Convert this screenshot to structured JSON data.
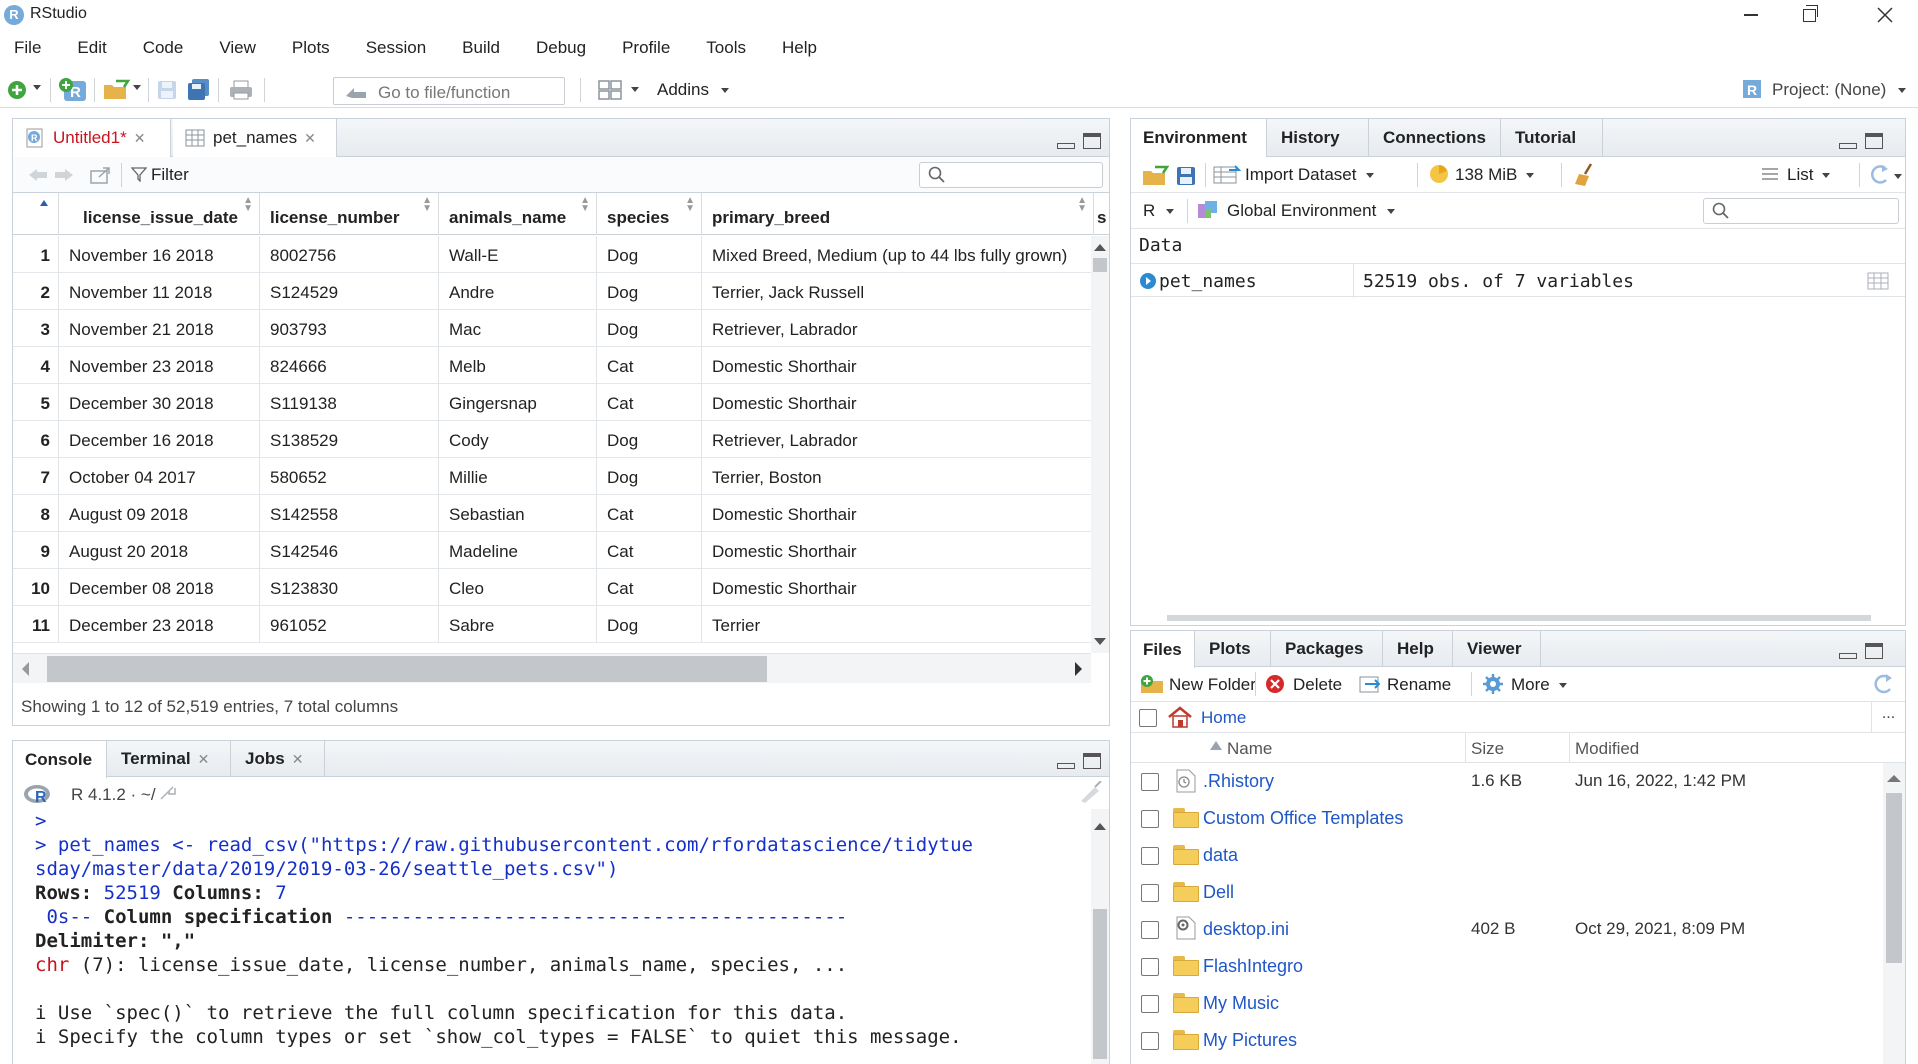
{
  "app": {
    "title": "RStudio",
    "logo_letter": "R"
  },
  "menu": [
    "File",
    "Edit",
    "Code",
    "View",
    "Plots",
    "Session",
    "Build",
    "Debug",
    "Profile",
    "Tools",
    "Help"
  ],
  "toolbar": {
    "goto_placeholder": "Go to file/function",
    "addins": "Addins",
    "project": "Project: (None)"
  },
  "source_pane": {
    "tabs": [
      {
        "label": "Untitled1*",
        "modified": true
      },
      {
        "label": "pet_names",
        "modified": false
      }
    ],
    "filter_label": "Filter",
    "columns": [
      "license_issue_date",
      "license_number",
      "animals_name",
      "species",
      "primary_breed",
      "s"
    ],
    "rows": [
      {
        "n": "1",
        "date": "November 16 2018",
        "license": "8002756",
        "name": "Wall-E",
        "species": "Dog",
        "breed": "Mixed Breed, Medium (up to 44 lbs fully grown)"
      },
      {
        "n": "2",
        "date": "November 11 2018",
        "license": "S124529",
        "name": "Andre",
        "species": "Dog",
        "breed": "Terrier, Jack Russell"
      },
      {
        "n": "3",
        "date": "November 21 2018",
        "license": "903793",
        "name": "Mac",
        "species": "Dog",
        "breed": "Retriever, Labrador"
      },
      {
        "n": "4",
        "date": "November 23 2018",
        "license": "824666",
        "name": "Melb",
        "species": "Cat",
        "breed": "Domestic Shorthair"
      },
      {
        "n": "5",
        "date": "December 30 2018",
        "license": "S119138",
        "name": "Gingersnap",
        "species": "Cat",
        "breed": "Domestic Shorthair"
      },
      {
        "n": "6",
        "date": "December 16 2018",
        "license": "S138529",
        "name": "Cody",
        "species": "Dog",
        "breed": "Retriever, Labrador"
      },
      {
        "n": "7",
        "date": "October 04 2017",
        "license": "580652",
        "name": "Millie",
        "species": "Dog",
        "breed": "Terrier, Boston"
      },
      {
        "n": "8",
        "date": "August 09 2018",
        "license": "S142558",
        "name": "Sebastian",
        "species": "Cat",
        "breed": "Domestic Shorthair"
      },
      {
        "n": "9",
        "date": "August 20 2018",
        "license": "S142546",
        "name": "Madeline",
        "species": "Cat",
        "breed": "Domestic Shorthair"
      },
      {
        "n": "10",
        "date": "December 08 2018",
        "license": "S123830",
        "name": "Cleo",
        "species": "Cat",
        "breed": "Domestic Shorthair"
      },
      {
        "n": "11",
        "date": "December 23 2018",
        "license": "961052",
        "name": "Sabre",
        "species": "Dog",
        "breed": "Terrier"
      }
    ],
    "status": "Showing 1 to 12 of 52,519 entries, 7 total columns"
  },
  "console_pane": {
    "tabs": [
      "Console",
      "Terminal",
      "Jobs"
    ],
    "r_version": "R 4.1.2 · ~/",
    "prompt": ">",
    "cmd_line1": "> pet_names <- read_csv(\"https://raw.githubusercontent.com/rfordatascience/tidytue",
    "cmd_line2": "sday/master/data/2019/2019-03-26/seattle_pets.csv\")",
    "rows_label": "Rows: ",
    "rows_value": "52519",
    "cols_label": " Columns: ",
    "cols_value": "7",
    "spec_prefix": " 0s-- ",
    "spec_title": "Column specification",
    "spec_rule": " --------------------------------------------",
    "delimiter": "Delimiter: \",\"",
    "chr_label": "chr",
    "chr_rest": " (7): license_issue_date, license_number, animals_name, species, ...",
    "info1": "i Use `spec()` to retrieve the full column specification for this data.",
    "info2": "i Specify the column types or set `show_col_types = FALSE` to quiet this message."
  },
  "env_pane": {
    "tabs": [
      "Environment",
      "History",
      "Connections",
      "Tutorial"
    ],
    "import_dataset": "Import Dataset",
    "memory": "138 MiB",
    "view_mode": "List",
    "language": "R",
    "scope": "Global Environment",
    "section": "Data",
    "objects": [
      {
        "name": "pet_names",
        "desc": "52519 obs. of 7 variables"
      }
    ]
  },
  "files_pane": {
    "tabs": [
      "Files",
      "Plots",
      "Packages",
      "Help",
      "Viewer"
    ],
    "actions": {
      "new_folder": "New Folder",
      "delete": "Delete",
      "rename": "Rename",
      "more": "More"
    },
    "breadcrumb": "Home",
    "columns": {
      "name": "Name",
      "size": "Size",
      "modified": "Modified"
    },
    "files": [
      {
        "name": ".Rhistory",
        "size": "1.6 KB",
        "modified": "Jun 16, 2022, 1:42 PM",
        "icon": "file-icon"
      },
      {
        "name": "Custom Office Templates",
        "size": "",
        "modified": "",
        "icon": "folder-icon"
      },
      {
        "name": "data",
        "size": "",
        "modified": "",
        "icon": "folder-icon"
      },
      {
        "name": "Dell",
        "size": "",
        "modified": "",
        "icon": "folder-icon"
      },
      {
        "name": "desktop.ini",
        "size": "402 B",
        "modified": "Oct 29, 2021, 8:09 PM",
        "icon": "gear-file-icon"
      },
      {
        "name": "FlashIntegro",
        "size": "",
        "modified": "",
        "icon": "folder-icon"
      },
      {
        "name": "My Music",
        "size": "",
        "modified": "",
        "icon": "folder-icon"
      },
      {
        "name": "My Pictures",
        "size": "",
        "modified": "",
        "icon": "folder-icon"
      }
    ]
  },
  "colors": {
    "accent": "#75aadb",
    "link": "#1f57c7",
    "console_blue": "#1530c8",
    "console_red": "#c8141e"
  }
}
